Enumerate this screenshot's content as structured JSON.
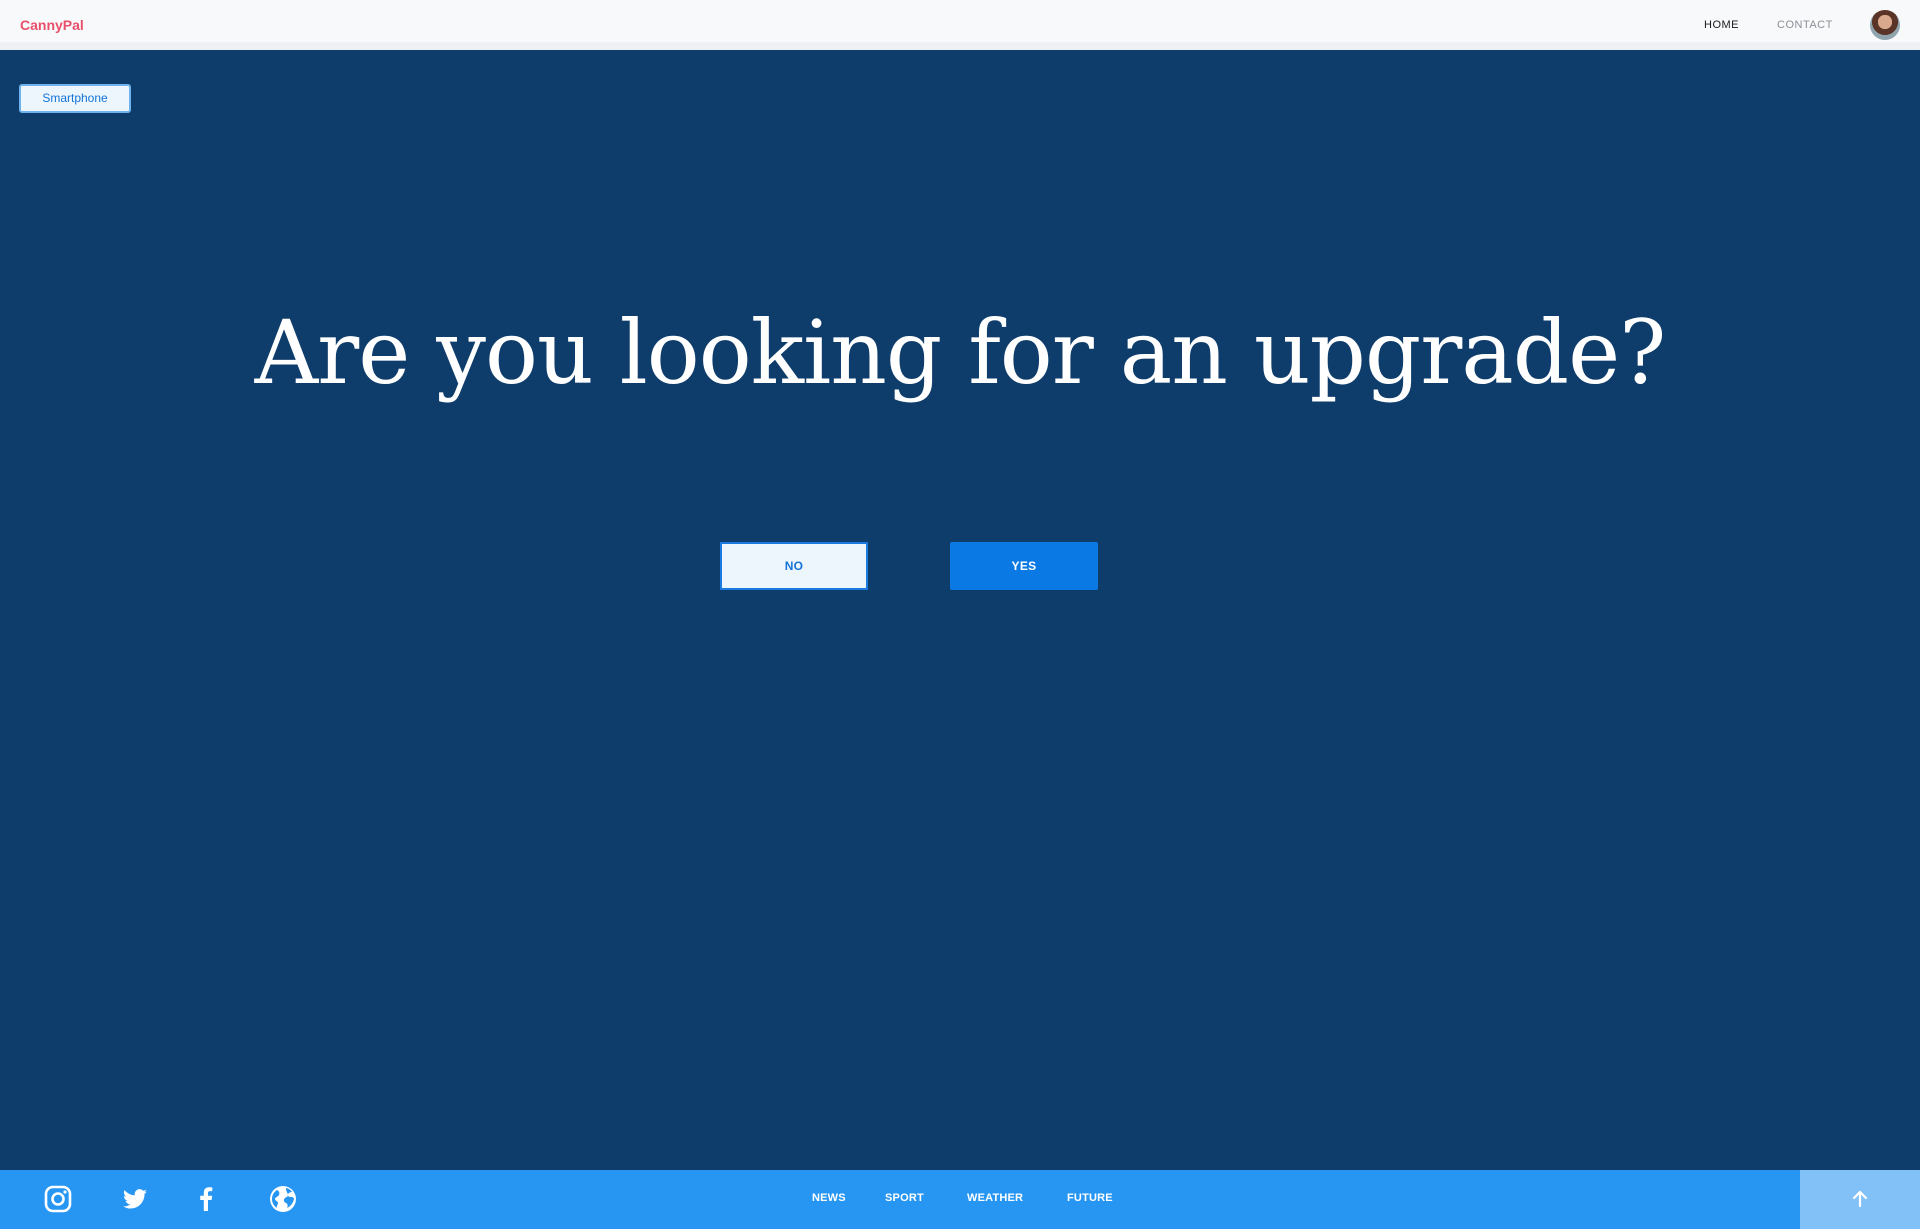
{
  "header": {
    "brand": "CannyPal",
    "nav": [
      {
        "label": "HOME"
      },
      {
        "label": "CONTACT"
      }
    ],
    "avatar_icon": "user-avatar"
  },
  "main": {
    "chip_label": "Smartphone",
    "headline": "Are you looking for an upgrade?",
    "buttons": {
      "no_label": "NO",
      "yes_label": "YES"
    }
  },
  "footer": {
    "social_icons": [
      "instagram-icon",
      "twitter-icon",
      "facebook-icon",
      "globe-icon"
    ],
    "links": [
      {
        "label": "NEWS"
      },
      {
        "label": "SPORT"
      },
      {
        "label": "WEATHER"
      },
      {
        "label": "FUTURE"
      }
    ],
    "back_to_top_icon": "arrow-up-icon"
  },
  "colors": {
    "brand": "#e8506a",
    "background": "#0e3c6b",
    "primary": "#0a79e3",
    "footer": "#2796f3",
    "back_to_top": "#82c1f8"
  }
}
